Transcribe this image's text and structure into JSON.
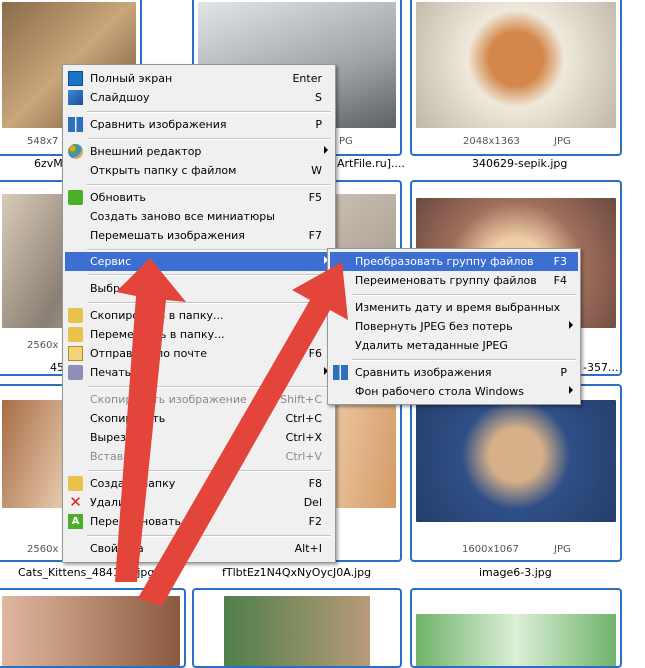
{
  "thumbnails": [
    {
      "id": "t1",
      "dims": "548x7",
      "ext": "",
      "name": "6zvM",
      "colors": [
        "#8a6b4a",
        "#c9a67a"
      ]
    },
    {
      "id": "t2",
      "dims": "",
      "ext": "PG",
      "name": "ArtFile.ru]....",
      "colors": [
        "#cfd3d6",
        "#7b7f82"
      ]
    },
    {
      "id": "t3",
      "dims": "2048x1363",
      "ext": "JPG",
      "name": "340629-sepik.jpg",
      "colors": [
        "#e9e4d8",
        "#c98a4a"
      ]
    },
    {
      "id": "t4",
      "dims": "2560x",
      "ext": "",
      "name": "45",
      "colors": [
        "#c9b8a3",
        "#6e655c"
      ]
    },
    {
      "id": "t5",
      "dims": "",
      "ext": "",
      "name": "",
      "colors": [
        "#d4c6b4",
        "#8f8579"
      ]
    },
    {
      "id": "t6",
      "dims": "",
      "ext": "",
      "name": "-357...",
      "colors": [
        "#a0786a",
        "#e7c9a8"
      ]
    },
    {
      "id": "t7",
      "dims": "2560x",
      "ext": "",
      "name": "Cats_Kittens_484103.jpg",
      "colors": [
        "#b47a54",
        "#e3c6a8"
      ]
    },
    {
      "id": "t8",
      "dims": "",
      "ext": "",
      "name": "fTlbtEz1N4QxNyOycJ0A.jpg",
      "colors": [
        "#c78a5a",
        "#f0d2b0"
      ]
    },
    {
      "id": "t9",
      "dims": "1600x1067",
      "ext": "JPG",
      "name": "image6-3.jpg",
      "colors": [
        "#2f4f86",
        "#c9a47a"
      ]
    },
    {
      "id": "t10",
      "dims": "",
      "ext": "",
      "name": "",
      "colors": [
        "#e0b8a0",
        "#8a5a40"
      ]
    },
    {
      "id": "t11",
      "dims": "",
      "ext": "",
      "name": "",
      "colors": [
        "#4f7f4a",
        "#b89a7a"
      ]
    },
    {
      "id": "t12",
      "dims": "",
      "ext": "",
      "name": "",
      "colors": [
        "#6fb36a",
        "#dcefd8"
      ]
    }
  ],
  "context_menu": {
    "items": [
      {
        "label": "Полный экран",
        "key": "Enter",
        "icon": "fullscreen-icon"
      },
      {
        "label": "Слайдшоу",
        "key": "S",
        "icon": "slideshow-icon"
      },
      {
        "label": "Сравнить изображения",
        "key": "P",
        "icon": "compare-icon"
      },
      {
        "label": "Внешний редактор",
        "key": "",
        "icon": "palette-icon"
      },
      {
        "label": "Открыть папку с файлом",
        "key": "W",
        "icon": ""
      },
      {
        "label": "Обновить",
        "key": "F5",
        "icon": "refresh-icon"
      },
      {
        "label": "Создать заново все миниатюры",
        "key": "",
        "icon": ""
      },
      {
        "label": "Перемешать изображения",
        "key": "F7",
        "icon": ""
      },
      {
        "label": "Сервис",
        "key": "",
        "icon": ""
      },
      {
        "label": "Выбрать",
        "key": "",
        "icon": ""
      },
      {
        "label": "Скопировать в папку...",
        "key": "",
        "icon": "copy-to-folder-icon"
      },
      {
        "label": "Переместить в папку...",
        "key": "",
        "icon": "move-to-folder-icon"
      },
      {
        "label": "Отправить по почте",
        "key": "F6",
        "icon": "mail-icon"
      },
      {
        "label": "Печать",
        "key": "",
        "icon": "print-icon"
      },
      {
        "label": "Скопировать изображение",
        "key": "Shift+C",
        "icon": ""
      },
      {
        "label": "Скопировать",
        "key": "Ctrl+C",
        "icon": ""
      },
      {
        "label": "Вырезать",
        "key": "Ctrl+X",
        "icon": ""
      },
      {
        "label": "Вставить",
        "key": "Ctrl+V",
        "icon": ""
      },
      {
        "label": "Создать папку",
        "key": "F8",
        "icon": "new-folder-icon"
      },
      {
        "label": "Удалить",
        "key": "Del",
        "icon": "delete-icon"
      },
      {
        "label": "Переименовать",
        "key": "F2",
        "icon": "rename-icon"
      },
      {
        "label": "Свойства",
        "key": "Alt+I",
        "icon": ""
      }
    ]
  },
  "service_submenu": {
    "items": [
      {
        "label": "Преобразовать группу файлов",
        "key": "F3"
      },
      {
        "label": "Переименовать группу файлов",
        "key": "F4"
      },
      {
        "label": "Изменить дату и время выбранных",
        "key": ""
      },
      {
        "label": "Повернуть JPEG без потерь",
        "key": ""
      },
      {
        "label": "Удалить метаданные JPEG",
        "key": ""
      },
      {
        "label": "Сравнить изображения",
        "key": "P"
      },
      {
        "label": "Фон рабочего стола Windows",
        "key": ""
      }
    ]
  },
  "colors": {
    "selection": "#3c6fd1",
    "thumb_border": "#2b6fc4",
    "arrow": "#e3453a"
  }
}
